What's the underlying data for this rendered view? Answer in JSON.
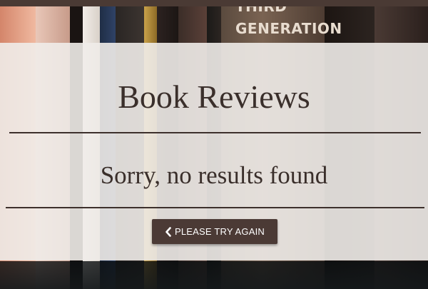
{
  "background": {
    "book_spine_texts": [
      "THIRD",
      "GENERATION"
    ]
  },
  "main": {
    "title": "Book Reviews",
    "message": "Sorry, no results found",
    "retry_button_label": "PLEASE TRY AGAIN"
  },
  "icons": {
    "retry": "chevron-left-icon"
  },
  "colors": {
    "top_bar": "#4a3a34",
    "text": "#3a2f2b",
    "button": "#4b3a35",
    "overlay": "#f0ece9"
  }
}
